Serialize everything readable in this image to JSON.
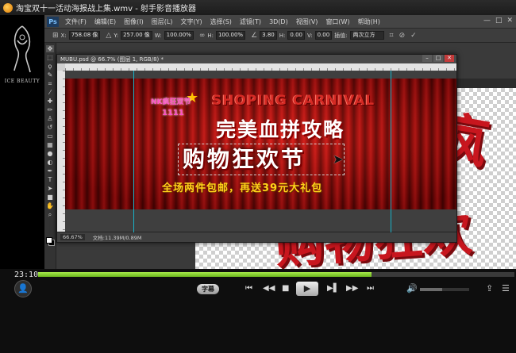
{
  "player": {
    "window_title": "淘宝双十一活动海报战上集.wmv - 射手影音播放器",
    "current_time": "23:10",
    "progress_fraction": 0.7,
    "volume_fraction": 0.45,
    "subtitle_label": "字幕",
    "brand_text": "ICE BEAUTY"
  },
  "photoshop": {
    "logo": "Ps",
    "menus": [
      "文件(F)",
      "编辑(E)",
      "图像(I)",
      "图层(L)",
      "文字(Y)",
      "选择(S)",
      "滤镜(T)",
      "3D(D)",
      "视图(V)",
      "窗口(W)",
      "帮助(H)"
    ],
    "options": {
      "x_label": "X:",
      "x_value": "758.08 像",
      "y_label": "Y:",
      "y_value": "257.00 像",
      "w_label": "W:",
      "w_value": "100.00%",
      "h_label": "H:",
      "h_value": "100.00%",
      "angle_value": "3.80",
      "hskew_label": "H:",
      "hskew_value": "0.00",
      "vskew_label": "V:",
      "vskew_value": "0.00",
      "interp_value": "两次立方"
    },
    "document": {
      "tab_title": "MUBU.psd @ 66.7% (图层 1, RGB/8) *",
      "zoom": "66.67%",
      "doc_info": "文档:11.39M/0.89M"
    }
  },
  "banner": {
    "line_english": "SHOPING CARNIVAL",
    "line_strategy": "完美血拼攻略",
    "line_mad": "购物狂欢节",
    "line_sub": "全场两件包邮，再送39元大礼包",
    "badge_top": "NK疯狂双节",
    "badge_bottom": "1111"
  },
  "background_doc": {
    "big_text_1": "疯",
    "big_text_2": "购物狂欢"
  },
  "colors": {
    "accent_progress": "#8fd534",
    "banner_red": "#c8161e",
    "banner_yellow": "#ffd21a",
    "guide_cyan": "#19b2c8"
  }
}
